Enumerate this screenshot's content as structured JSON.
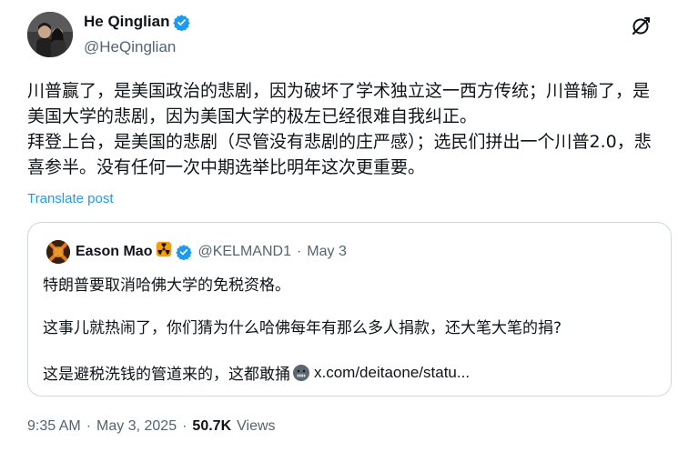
{
  "author": {
    "name": "He Qinglian",
    "handle": "@HeQinglian"
  },
  "tweet": {
    "text_para1": "川普赢了，是美国政治的悲剧，因为破坏了学术独立这一西方传统；川普输了，是美国大学的悲剧，因为美国大学的极左已经很难自我纠正。",
    "text_para2": "拜登上台，是美国的悲剧（尽管没有悲剧的庄严感）；选民们拼出一个川普2.0，悲喜参半。没有任何一次中期选举比明年这次更重要。",
    "translate_label": "Translate post"
  },
  "quote": {
    "name": "Eason Mao",
    "name_emoji": "☢️",
    "handle": "@KELMAND1",
    "separator": "·",
    "date": "May 3",
    "line1": "特朗普要取消哈佛大学的免税资格。",
    "line2": "这事儿就热闹了，你们猜为什么哈佛每年有那么多人捐款，还大笔大笔的捐?",
    "line3_prefix": "这是避税洗钱的管道来的，这都敢捅",
    "line3_link": "x.com/deitaone/statu..."
  },
  "meta": {
    "time": "9:35 AM",
    "dot1": "·",
    "date": "May 3, 2025",
    "dot2": "·",
    "views_count": "50.7K",
    "views_label": "Views"
  },
  "colors": {
    "accent": "#1d9bf0",
    "text": "#0f1419",
    "muted": "#536471",
    "border": "#cfd9de"
  },
  "icons": {
    "verified": "verified-badge-icon",
    "grok": "grok-icon",
    "radioactive": "radioactive-icon",
    "face": "grimace-face-icon"
  }
}
